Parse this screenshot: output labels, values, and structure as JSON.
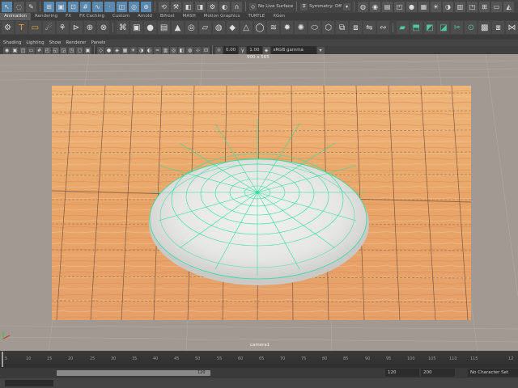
{
  "status_line": {
    "live_surface": "No Live Surface",
    "symmetry": "Symmetry: Off"
  },
  "shelf": {
    "tabs": [
      "Animation",
      "Rendering",
      "FX",
      "FX Caching",
      "Custom",
      "Arnold",
      "Bifrost",
      "MASH",
      "Motion Graphics",
      "TURTLE",
      "XGen"
    ]
  },
  "panel_menu": [
    "Shading",
    "Lighting",
    "Show",
    "Renderer",
    "Panels"
  ],
  "panel_toolbar": {
    "field_a": "0.00",
    "field_b": "1.00",
    "color_space": "sRGB gamma"
  },
  "viewport": {
    "resolution_gate": "900 x 565",
    "camera_name": "camera1"
  },
  "time_slider": {
    "ticks": [
      "5",
      "10",
      "15",
      "20",
      "25",
      "30",
      "35",
      "40",
      "45",
      "50",
      "55",
      "60",
      "65",
      "70",
      "75",
      "80",
      "85",
      "90",
      "95",
      "100",
      "105",
      "110",
      "115",
      "12"
    ]
  },
  "range_slider": {
    "playback_end": "120",
    "range_end": "120",
    "anim_end": "200",
    "character_set": "No Character Set"
  },
  "colors": {
    "wood": "#e8a868",
    "plate": "#e4e4e2",
    "wire": "#2fe0a0",
    "selected_icon": "#5a89b0"
  }
}
